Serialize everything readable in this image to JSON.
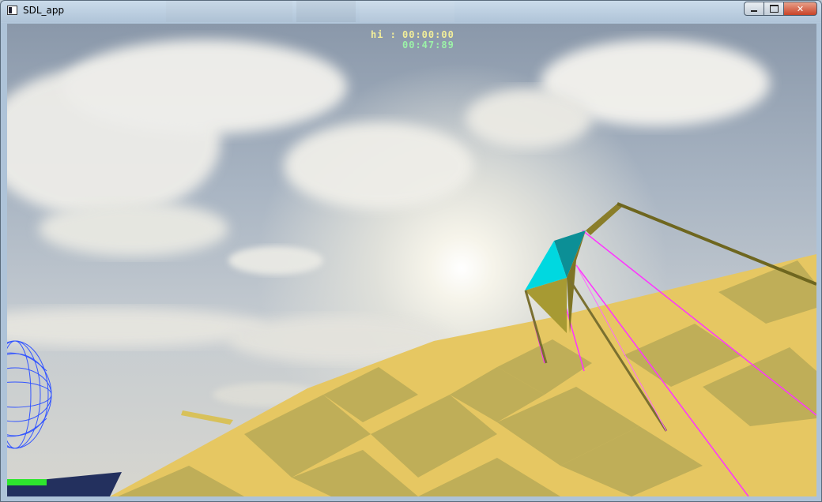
{
  "window": {
    "title": "SDL_app",
    "controls": {
      "minimize_icon": "minimize-icon",
      "maximize_icon": "maximize-icon",
      "close_icon": "close-icon"
    }
  },
  "hud": {
    "hi_label": "hi :",
    "best_time": "00:00:00",
    "current_time": "00:47:89",
    "colors": {
      "hi": "#f2ee9a",
      "current": "#9cf2a8"
    }
  },
  "meter": {
    "color": "#2ee62e"
  },
  "scene": {
    "colors": {
      "sky": "#a9b5c3",
      "floor_light": "#e6c762",
      "floor_dark": "#bfae58",
      "kite_cyan": "#00d8e0",
      "kite_olive": "#8a7e2a",
      "lines": "#ff33ff",
      "wireframe": "#3355ff"
    }
  }
}
